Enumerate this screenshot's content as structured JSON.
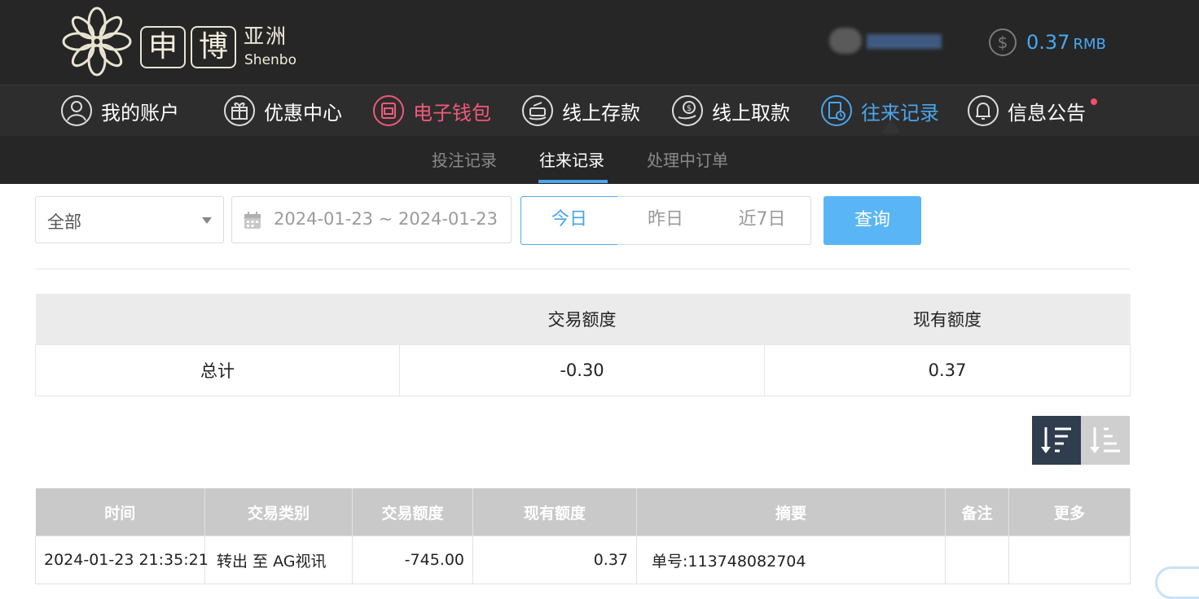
{
  "header": {
    "logo": {
      "char1": "申",
      "char2": "博",
      "cn": "亚洲",
      "en": "Shenbo"
    },
    "balance": {
      "amount": "0.37",
      "unit": "RMB"
    }
  },
  "nav": [
    {
      "label": "我的账户",
      "icon": "user-icon"
    },
    {
      "label": "优惠中心",
      "icon": "gift-icon"
    },
    {
      "label": "电子钱包",
      "icon": "wallet-icon"
    },
    {
      "label": "线上存款",
      "icon": "deposit-icon"
    },
    {
      "label": "线上取款",
      "icon": "withdraw-icon"
    },
    {
      "label": "往来记录",
      "icon": "records-icon"
    },
    {
      "label": "信息公告",
      "icon": "bell-icon"
    }
  ],
  "subnav": {
    "tabs": [
      "投注记录",
      "往来记录",
      "处理中订单"
    ],
    "active": "往来记录"
  },
  "filters": {
    "type_select": "全部",
    "date_range": "2024-01-23 ~ 2024-01-23",
    "quick": [
      "今日",
      "昨日",
      "近7日"
    ],
    "query_label": "查询"
  },
  "summary": {
    "headers": [
      "",
      "交易额度",
      "现有额度"
    ],
    "row": {
      "label": "总计",
      "trade_amount": "-0.30",
      "balance": "0.37"
    }
  },
  "records": {
    "headers": [
      "时间",
      "交易类别",
      "交易额度",
      "现有额度",
      "摘要",
      "备注",
      "更多"
    ],
    "rows": [
      {
        "time": "2024-01-23 21:35:21",
        "type": "转出 至 AG视讯",
        "amount": "-745.00",
        "balance": "0.37",
        "summary": "单号:113748082704",
        "note": "",
        "more": ""
      }
    ]
  },
  "colors": {
    "accent": "#4aa5ea",
    "wallet_red": "#f05a79",
    "header_bg": "#262626",
    "query_btn": "#5ab5f6"
  }
}
